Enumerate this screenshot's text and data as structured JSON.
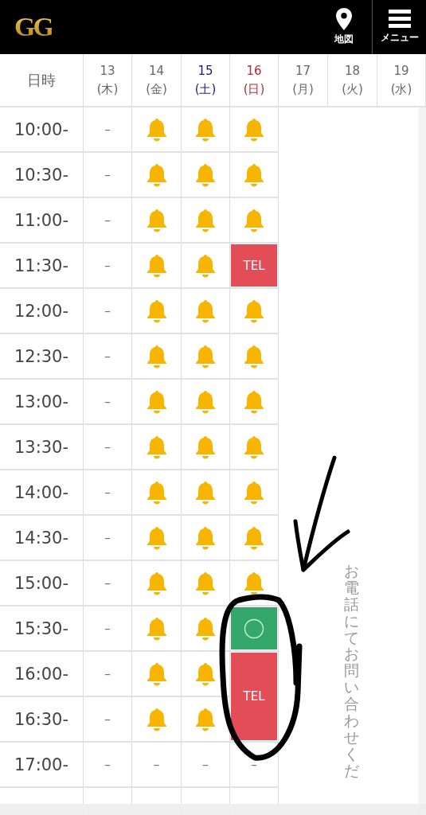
{
  "header": {
    "logo": "GG",
    "map_label": "地図",
    "menu_label": "メニュー"
  },
  "table": {
    "corner": "日時",
    "days": [
      {
        "date": "13",
        "weekday": "(木)",
        "kind": "weekday"
      },
      {
        "date": "14",
        "weekday": "(金)",
        "kind": "weekday"
      },
      {
        "date": "15",
        "weekday": "(土)",
        "kind": "saturday"
      },
      {
        "date": "16",
        "weekday": "(日)",
        "kind": "sunday"
      },
      {
        "date": "17",
        "weekday": "(月)",
        "kind": "weekday"
      },
      {
        "date": "18",
        "weekday": "(火)",
        "kind": "weekday"
      },
      {
        "date": "19",
        "weekday": "(水)",
        "kind": "weekday"
      }
    ],
    "rows": [
      {
        "time": "10:00-",
        "slots": [
          {
            "kind": "dash",
            "text": "–"
          },
          {
            "kind": "bell"
          },
          {
            "kind": "bell"
          },
          {
            "kind": "bell"
          }
        ]
      },
      {
        "time": "10:30-",
        "slots": [
          {
            "kind": "dash",
            "text": "–"
          },
          {
            "kind": "bell"
          },
          {
            "kind": "bell"
          },
          {
            "kind": "bell"
          }
        ]
      },
      {
        "time": "11:00-",
        "slots": [
          {
            "kind": "dash",
            "text": "–"
          },
          {
            "kind": "bell"
          },
          {
            "kind": "bell"
          },
          {
            "kind": "bell"
          }
        ]
      },
      {
        "time": "11:30-",
        "slots": [
          {
            "kind": "dash",
            "text": "–"
          },
          {
            "kind": "bell"
          },
          {
            "kind": "bell"
          },
          {
            "kind": "tel",
            "text": "TEL",
            "tall": false
          }
        ]
      },
      {
        "time": "12:00-",
        "slots": [
          {
            "kind": "dash",
            "text": "–"
          },
          {
            "kind": "bell"
          },
          {
            "kind": "bell"
          },
          {
            "kind": "bell"
          }
        ]
      },
      {
        "time": "12:30-",
        "slots": [
          {
            "kind": "dash",
            "text": "–"
          },
          {
            "kind": "bell"
          },
          {
            "kind": "bell"
          },
          {
            "kind": "bell"
          }
        ]
      },
      {
        "time": "13:00-",
        "slots": [
          {
            "kind": "dash",
            "text": "–"
          },
          {
            "kind": "bell"
          },
          {
            "kind": "bell"
          },
          {
            "kind": "bell"
          }
        ]
      },
      {
        "time": "13:30-",
        "slots": [
          {
            "kind": "dash",
            "text": "–"
          },
          {
            "kind": "bell"
          },
          {
            "kind": "bell"
          },
          {
            "kind": "bell"
          }
        ]
      },
      {
        "time": "14:00-",
        "slots": [
          {
            "kind": "dash",
            "text": "–"
          },
          {
            "kind": "bell"
          },
          {
            "kind": "bell"
          },
          {
            "kind": "bell"
          }
        ]
      },
      {
        "time": "14:30-",
        "slots": [
          {
            "kind": "dash",
            "text": "–"
          },
          {
            "kind": "bell"
          },
          {
            "kind": "bell"
          },
          {
            "kind": "bell"
          }
        ]
      },
      {
        "time": "15:00-",
        "slots": [
          {
            "kind": "dash",
            "text": "–"
          },
          {
            "kind": "bell"
          },
          {
            "kind": "bell"
          },
          {
            "kind": "bell"
          }
        ]
      },
      {
        "time": "15:30-",
        "slots": [
          {
            "kind": "dash",
            "text": "–"
          },
          {
            "kind": "bell"
          },
          {
            "kind": "bell"
          },
          {
            "kind": "open"
          }
        ]
      },
      {
        "time": "16:00-",
        "slots": [
          {
            "kind": "dash",
            "text": "–"
          },
          {
            "kind": "bell"
          },
          {
            "kind": "bell"
          },
          {
            "kind": "tel",
            "text": "TEL",
            "tall": true
          }
        ]
      },
      {
        "time": "16:30-",
        "slots": [
          {
            "kind": "dash",
            "text": "–"
          },
          {
            "kind": "bell"
          },
          {
            "kind": "bell"
          }
        ]
      },
      {
        "time": "17:00-",
        "slots": [
          {
            "kind": "dash",
            "text": "–"
          },
          {
            "kind": "dash",
            "text": "–"
          },
          {
            "kind": "dash",
            "text": "–"
          },
          {
            "kind": "dash",
            "text": "–"
          }
        ]
      }
    ],
    "notice": "お電話にてお問い合わせくだ"
  }
}
